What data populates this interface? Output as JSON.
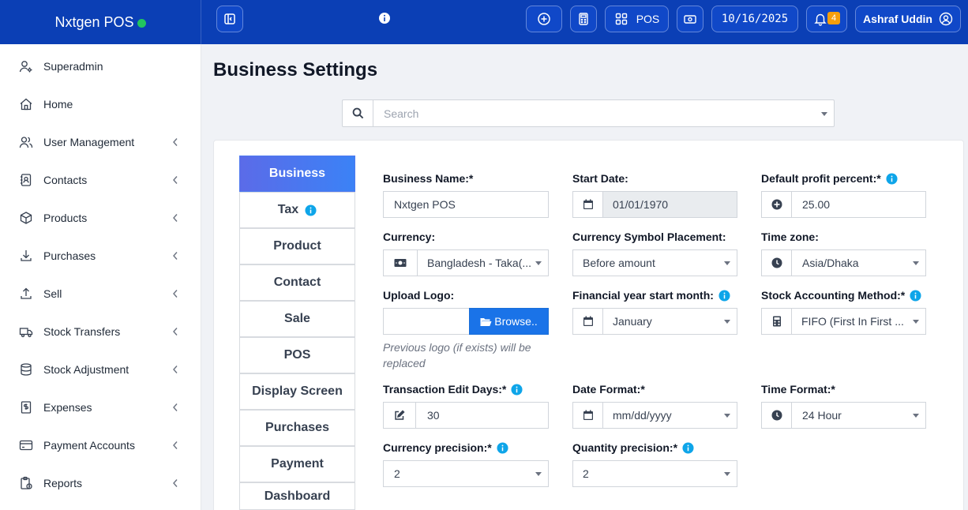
{
  "topbar": {
    "brand": "Nxtgen POS",
    "pos_label": "POS",
    "date": "10/16/2025",
    "notification_count": "4",
    "user_name": "Ashraf Uddin"
  },
  "sidebar": {
    "items": [
      {
        "label": "Superadmin",
        "icon": "user-cog-icon"
      },
      {
        "label": "Home",
        "icon": "home-icon"
      },
      {
        "label": "User Management",
        "icon": "users-icon"
      },
      {
        "label": "Contacts",
        "icon": "address-book-icon"
      },
      {
        "label": "Products",
        "icon": "box-icon"
      },
      {
        "label": "Purchases",
        "icon": "download-icon"
      },
      {
        "label": "Sell",
        "icon": "upload-icon"
      },
      {
        "label": "Stock Transfers",
        "icon": "truck-icon"
      },
      {
        "label": "Stock Adjustment",
        "icon": "database-icon"
      },
      {
        "label": "Expenses",
        "icon": "receipt-icon"
      },
      {
        "label": "Payment Accounts",
        "icon": "credit-card-icon"
      },
      {
        "label": "Reports",
        "icon": "report-icon"
      }
    ]
  },
  "page": {
    "title": "Business Settings",
    "search_placeholder": "Search"
  },
  "tabs": [
    {
      "label": "Business",
      "active": true
    },
    {
      "label": "Tax",
      "active": false
    },
    {
      "label": "Product",
      "active": false
    },
    {
      "label": "Contact",
      "active": false
    },
    {
      "label": "Sale",
      "active": false
    },
    {
      "label": "POS",
      "active": false
    },
    {
      "label": "Display Screen",
      "active": false
    },
    {
      "label": "Purchases",
      "active": false
    },
    {
      "label": "Payment",
      "active": false
    },
    {
      "label": "Dashboard",
      "active": false
    }
  ],
  "form": {
    "business_name": {
      "label": "Business Name:*",
      "value": "Nxtgen POS"
    },
    "start_date": {
      "label": "Start Date:",
      "value": "01/01/1970"
    },
    "profit_percent": {
      "label": "Default profit percent:*",
      "value": "25.00"
    },
    "currency": {
      "label": "Currency:",
      "value": "Bangladesh - Taka(..."
    },
    "symbol_placement": {
      "label": "Currency Symbol Placement:",
      "value": "Before amount"
    },
    "time_zone": {
      "label": "Time zone:",
      "value": "Asia/Dhaka"
    },
    "upload_logo": {
      "label": "Upload Logo:",
      "button": "Browse..",
      "help": "Previous logo (if exists) will be replaced"
    },
    "fy_start_month": {
      "label": "Financial year start month:",
      "value": "January"
    },
    "stock_method": {
      "label": "Stock Accounting Method:*",
      "value": "FIFO (First In First ..."
    },
    "edit_days": {
      "label": "Transaction Edit Days:*",
      "value": "30"
    },
    "date_format": {
      "label": "Date Format:*",
      "value": "mm/dd/yyyy"
    },
    "time_format": {
      "label": "Time Format:*",
      "value": "24 Hour"
    },
    "currency_precision": {
      "label": "Currency precision:*",
      "value": "2"
    },
    "quantity_precision": {
      "label": "Quantity precision:*",
      "value": "2"
    }
  },
  "colors": {
    "topbar": "#0b3fb5",
    "accent": "#1a73e8",
    "info": "#0ea5e9",
    "status_online": "#22c55e",
    "badge": "#f59e0b"
  }
}
